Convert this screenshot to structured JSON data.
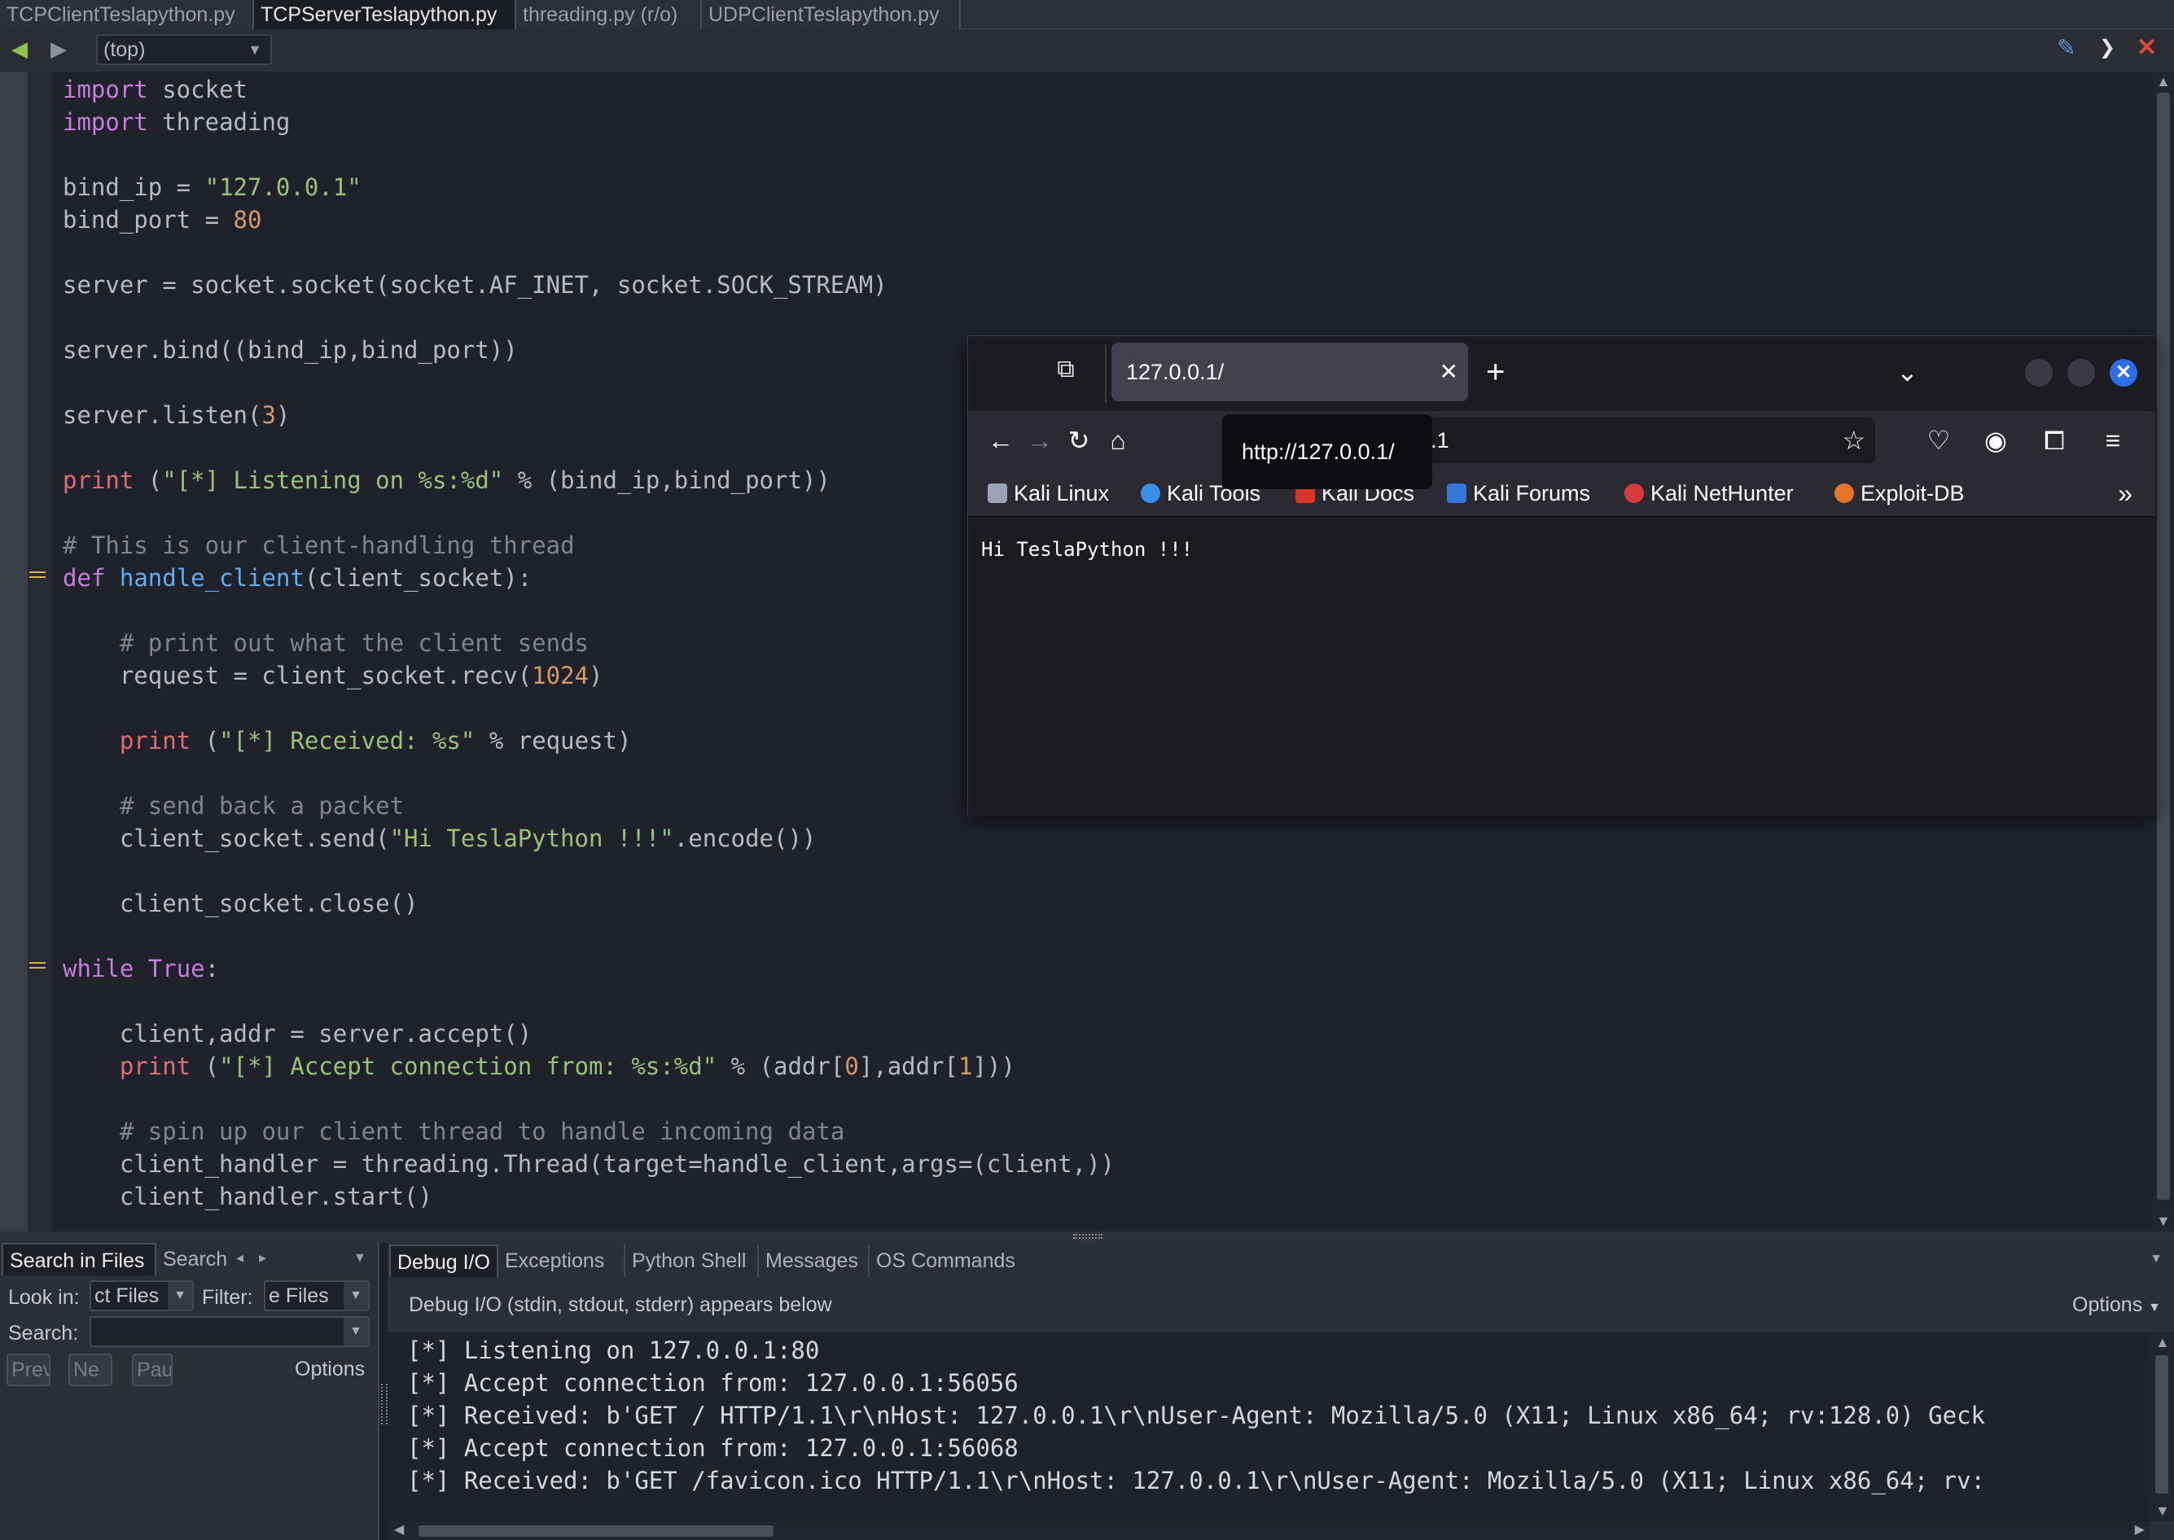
{
  "editor_tabs": [
    {
      "label": "TCPClientTeslapython.py",
      "active": false
    },
    {
      "label": "TCPServerTeslapython.py",
      "active": true
    },
    {
      "label": "threading.py (r/o)",
      "active": false
    },
    {
      "label": "UDPClientTeslapython.py",
      "active": false
    }
  ],
  "toolbar": {
    "scope": "(top)",
    "icons": [
      "back-arrow-icon",
      "forward-arrow-icon",
      "pin-icon",
      "options-chevron-icon",
      "close-icon"
    ]
  },
  "code_lines": [
    "import socket",
    "import threading",
    "",
    "bind_ip = \"127.0.0.1\"",
    "bind_port = 80",
    "",
    "server = socket.socket(socket.AF_INET, socket.SOCK_STREAM)",
    "",
    "server.bind((bind_ip,bind_port))",
    "",
    "server.listen(3)",
    "",
    "print (\"[*] Listening on %s:%d\" % (bind_ip,bind_port))",
    "",
    "# This is our client-handling thread",
    "def handle_client(client_socket):",
    "",
    "    # print out what the client sends",
    "    request = client_socket.recv(1024)",
    "",
    "    print (\"[*] Received: %s\" % request)",
    "",
    "    # send back a packet",
    "    client_socket.send(\"Hi TeslaPython !!!\".encode())",
    "",
    "    client_socket.close()",
    "",
    "while True:",
    "",
    "    client,addr = server.accept()",
    "    print (\"[*] Accept connection from: %s:%d\" % (addr[0],addr[1]))",
    "",
    "    # spin up our client thread to handle incoming data",
    "    client_handler = threading.Thread(target=handle_client,args=(client,))",
    "    client_handler.start()"
  ],
  "browser": {
    "tab_title": "127.0.0.1/",
    "url": "127.0.0.1",
    "tooltip": "http://127.0.0.1/",
    "bookmarks": [
      {
        "label": "Kali Linux",
        "icon": "kali-dragon-icon",
        "color": "#9aa4b8"
      },
      {
        "label": "Kali Tools",
        "icon": "kali-tools-icon",
        "color": "#3b8eea"
      },
      {
        "label": "Kali Docs",
        "icon": "kali-docs-icon",
        "color": "#d8342c"
      },
      {
        "label": "Kali Forums",
        "icon": "kali-forums-icon",
        "color": "#3576d9"
      },
      {
        "label": "Kali NetHunter",
        "icon": "kali-nethunter-icon",
        "color": "#d83a3a"
      },
      {
        "label": "Exploit-DB",
        "icon": "exploit-db-icon",
        "color": "#e8732a"
      }
    ],
    "page_text": "Hi TeslaPython !!!",
    "accent": "#2f6ee5"
  },
  "search_panel": {
    "tabs": [
      "Search in Files",
      "Search"
    ],
    "look_in_label": "Look in:",
    "look_in_value": "ct Files",
    "filter_label": "Filter:",
    "filter_value": "e Files",
    "search_label": "Search:",
    "search_value": "",
    "buttons": [
      "Previ",
      "Ne",
      "Pau"
    ],
    "options_label": "Options"
  },
  "debug_panel": {
    "tabs": [
      "Debug I/O",
      "Exceptions",
      "Python Shell",
      "Messages",
      "OS Commands"
    ],
    "caption": "Debug I/O (stdin, stdout, stderr) appears below",
    "options_label": "Options",
    "output": [
      "[*] Listening on 127.0.0.1:80",
      "[*] Accept connection from: 127.0.0.1:56056",
      "[*] Received: b'GET / HTTP/1.1\\r\\nHost: 127.0.0.1\\r\\nUser-Agent: Mozilla/5.0 (X11; Linux x86_64; rv:128.0) Geck",
      "[*] Accept connection from: 127.0.0.1:56068",
      "[*] Received: b'GET /favicon.ico HTTP/1.1\\r\\nHost: 127.0.0.1\\r\\nUser-Agent: Mozilla/5.0 (X11; Linux x86_64; rv:"
    ]
  }
}
